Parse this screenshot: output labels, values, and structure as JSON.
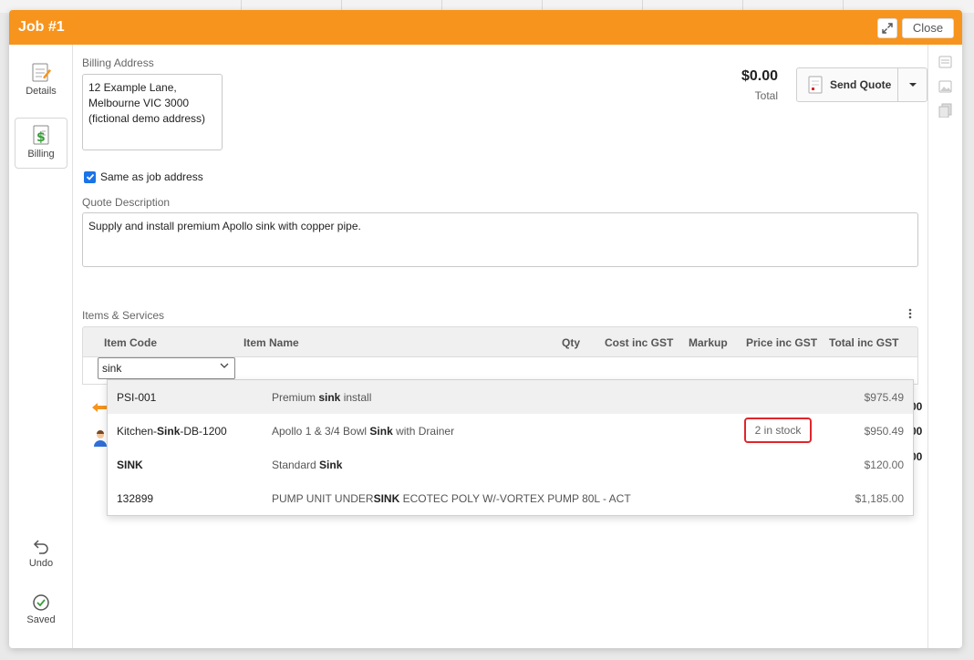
{
  "window": {
    "title": "Job #1",
    "close_label": "Close"
  },
  "left_rail": {
    "items": [
      {
        "label": "Details",
        "icon": "notepad-icon",
        "active": false
      },
      {
        "label": "Billing",
        "icon": "dollar-document-icon",
        "active": true
      }
    ],
    "bottom": [
      {
        "label": "Undo",
        "icon": "undo-icon"
      },
      {
        "label": "Saved",
        "icon": "saved-check-icon"
      }
    ]
  },
  "billing": {
    "address_label": "Billing Address",
    "address_value": "12 Example Lane,\nMelbourne VIC 3000\n(fictional demo address)",
    "same_as_job_label": "Same as job address",
    "same_as_job_checked": true
  },
  "totals": {
    "amount": "$0.00",
    "label": "Total"
  },
  "send_quote": {
    "label": "Send Quote"
  },
  "quote": {
    "description_label": "Quote Description",
    "description_value": "Supply and install premium Apollo sink with copper pipe."
  },
  "items": {
    "section_label": "Items & Services",
    "columns": [
      "Item Code",
      "Item Name",
      "Qty",
      "Cost inc GST",
      "Markup",
      "Price inc GST",
      "Total inc GST"
    ],
    "search_value": "sink",
    "behind_values": [
      "00",
      "00",
      "00"
    ]
  },
  "dropdown": {
    "rows": [
      {
        "code_parts": [
          "PSI-001"
        ],
        "name_parts": [
          "Premium ",
          "sink",
          " install"
        ],
        "stock": "",
        "price": "$975.49"
      },
      {
        "code_parts": [
          "Kitchen-",
          "Sink",
          "-DB-1200"
        ],
        "name_parts": [
          "Apollo 1 & 3/4 Bowl ",
          "Sink",
          " with Drainer"
        ],
        "stock": "2 in stock",
        "price": "$950.49"
      },
      {
        "code_parts": [
          "",
          "SINK",
          ""
        ],
        "name_parts": [
          "Standard ",
          "Sink",
          ""
        ],
        "stock": "",
        "price": "$120.00"
      },
      {
        "code_parts": [
          "132899"
        ],
        "name_parts": [
          "PUMP UNIT UNDER",
          "SINK",
          " ECOTEC POLY W/-VORTEX PUMP 80L - ACT"
        ],
        "stock": "",
        "price": "$1,185.00"
      }
    ]
  },
  "colors": {
    "header": "#f7941d",
    "highlight": "#e0262b",
    "checkbox": "#1a73e8"
  }
}
